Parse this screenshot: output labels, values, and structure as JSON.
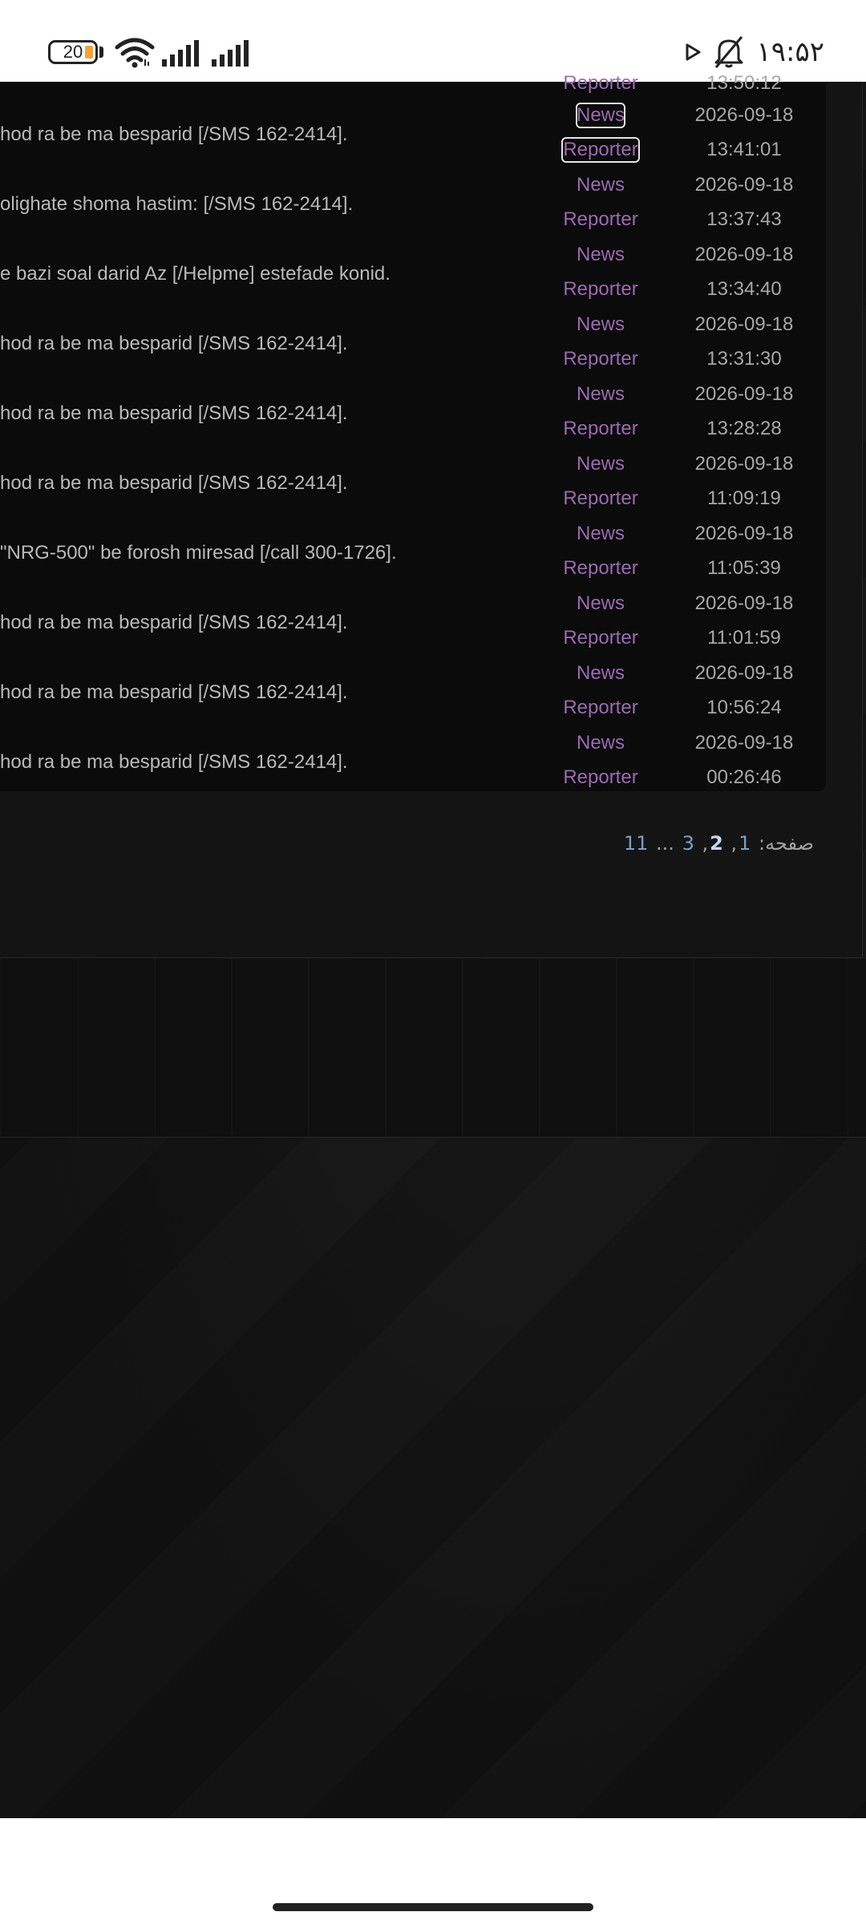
{
  "status_bar": {
    "battery_level": "20",
    "clock": "۱۹:۵۲",
    "icons": [
      "battery-icon",
      "wifi-icon",
      "signal-icon",
      "signal-icon",
      "play-icon",
      "bell-off-icon"
    ]
  },
  "rows_partial_top": {
    "link": "Reporter",
    "meta": "13:50:12"
  },
  "rows": [
    {
      "message": "hod ra be ma besparid [/SMS 162-2414].",
      "news": "News",
      "reporter": "Reporter",
      "date": "2026-09-18",
      "time": "13:41:01"
    },
    {
      "message": "olighate shoma hastim: [/SMS 162-2414].",
      "news": "News",
      "reporter": "Reporter",
      "date": "2026-09-18",
      "time": "13:37:43"
    },
    {
      "message": "e bazi soal darid Az [/Helpme] estefade konid.",
      "news": "News",
      "reporter": "Reporter",
      "date": "2026-09-18",
      "time": "13:34:40"
    },
    {
      "message": "hod ra be ma besparid [/SMS 162-2414].",
      "news": "News",
      "reporter": "Reporter",
      "date": "2026-09-18",
      "time": "13:31:30"
    },
    {
      "message": "hod ra be ma besparid [/SMS 162-2414].",
      "news": "News",
      "reporter": "Reporter",
      "date": "2026-09-18",
      "time": "13:28:28"
    },
    {
      "message": "hod ra be ma besparid [/SMS 162-2414].",
      "news": "News",
      "reporter": "Reporter",
      "date": "2026-09-18",
      "time": "11:09:19"
    },
    {
      "message": "\"NRG-500\" be forosh miresad [/call 300-1726].",
      "news": "News",
      "reporter": "Reporter",
      "date": "2026-09-18",
      "time": "11:05:39"
    },
    {
      "message": "hod ra be ma besparid [/SMS 162-2414].",
      "news": "News",
      "reporter": "Reporter",
      "date": "2026-09-18",
      "time": "11:01:59"
    },
    {
      "message": "hod ra be ma besparid [/SMS 162-2414].",
      "news": "News",
      "reporter": "Reporter",
      "date": "2026-09-18",
      "time": "10:56:24"
    },
    {
      "message": "hod ra be ma besparid [/SMS 162-2414].",
      "news": "News",
      "reporter": "Reporter",
      "date": "2026-09-18",
      "time": "00:26:46"
    }
  ],
  "pagination": {
    "label": "صفحه:",
    "page1": "1",
    "sep1": ",",
    "current": "2",
    "sep2": ",",
    "page3": "3",
    "ellipsis": "...",
    "last": "11"
  },
  "colors": {
    "link": "#9a6bb0",
    "page_link": "#7f9dc0",
    "background": "#111111"
  }
}
